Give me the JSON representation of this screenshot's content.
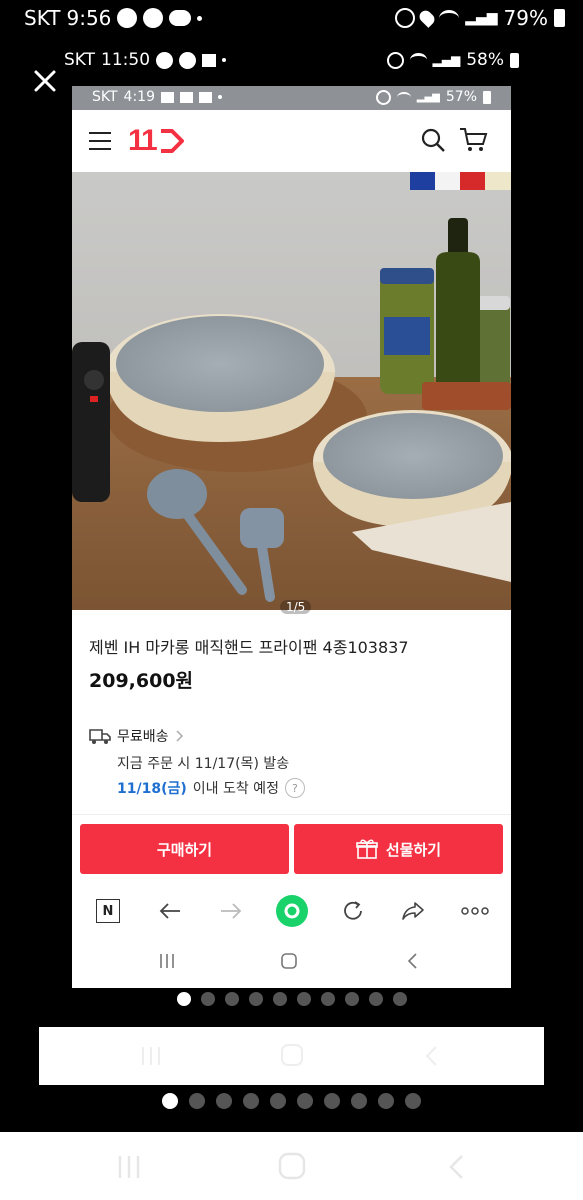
{
  "outer_status": {
    "carrier": "SKT",
    "time": "9:56",
    "battery": "79%"
  },
  "second_status": {
    "carrier": "SKT",
    "time": "11:50",
    "battery": "58%"
  },
  "inner_status": {
    "carrier": "SKT",
    "time": "4:19",
    "battery": "57%"
  },
  "header": {
    "logo": "11"
  },
  "product": {
    "image_counter": "1/5",
    "title": "제벤 IH 마카롱 매직핸드 프라이팬 4종103837",
    "price": "209,600원"
  },
  "shipping": {
    "label": "무료배송",
    "order_note": "지금 주문 시 11/17(목) 발송",
    "arrival_date": "11/18(금)",
    "arrival_suffix": "이내 도착 예정",
    "help": "?"
  },
  "actions": {
    "buy": "구매하기",
    "gift": "선물하기"
  },
  "browser_bar": {
    "n_label": "N"
  },
  "page_dots": {
    "count": 10,
    "active": 0
  },
  "colors": {
    "accent": "#f43142",
    "link_blue": "#1f6fd1"
  }
}
